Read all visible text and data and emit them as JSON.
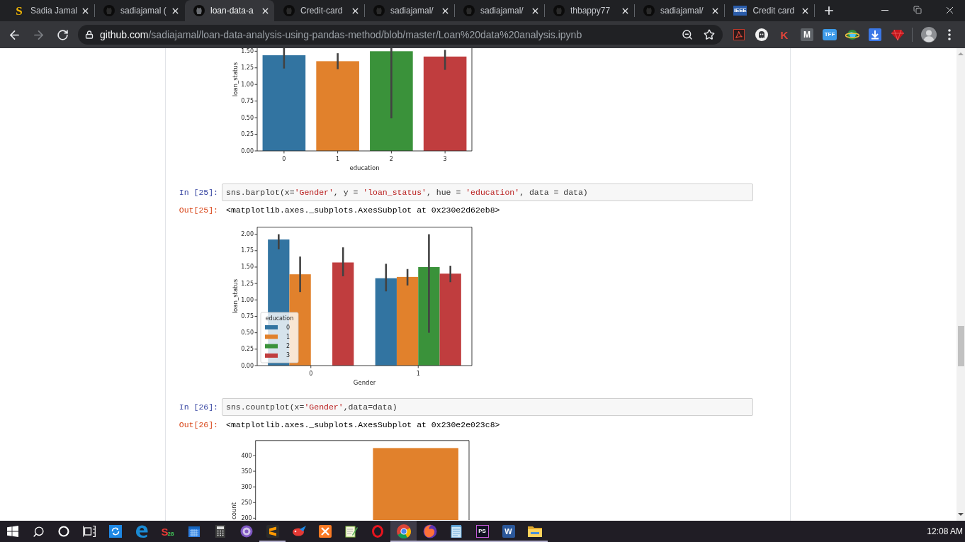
{
  "tabs": [
    {
      "title": "Sadia Jamal",
      "favicon": {
        "kind": "letter",
        "text": "S"
      },
      "selected": false
    },
    {
      "title": "sadiajamal (",
      "favicon": {
        "kind": "cat"
      },
      "selected": false
    },
    {
      "title": "loan-data-a",
      "favicon": {
        "kind": "cat"
      },
      "selected": true
    },
    {
      "title": "Credit-card",
      "favicon": {
        "kind": "cat"
      },
      "selected": false
    },
    {
      "title": "sadiajamal/",
      "favicon": {
        "kind": "cat"
      },
      "selected": false
    },
    {
      "title": "sadiajamal/",
      "favicon": {
        "kind": "cat"
      },
      "selected": false
    },
    {
      "title": "thbappy77",
      "favicon": {
        "kind": "cat"
      },
      "selected": false
    },
    {
      "title": "sadiajamal/",
      "favicon": {
        "kind": "cat"
      },
      "selected": false
    },
    {
      "title": "Credit card",
      "favicon": {
        "kind": "tile",
        "text": "IEEE"
      },
      "selected": false
    }
  ],
  "toolbar": {
    "back": {
      "disabled": false
    },
    "forward": {
      "disabled": true
    }
  },
  "address_bar": {
    "host": "github.com",
    "path": "/sadiajamal/loan-data-analysis-using-pandas-method/blob/master/Loan%20data%20analysis.ipynb"
  },
  "extensions": [
    {
      "kind": "pdf"
    },
    {
      "kind": "ghost"
    },
    {
      "kind": "letter",
      "text": "K"
    },
    {
      "kind": "square",
      "text": "M"
    },
    {
      "kind": "badge",
      "text": "TFF"
    },
    {
      "kind": "globe"
    },
    {
      "kind": "download"
    },
    {
      "kind": "gem"
    }
  ],
  "notebook": {
    "cells": [
      {
        "kind": "figure",
        "chart_data": {
          "type": "bar",
          "xlabel": "education",
          "ylabel": "loan_status",
          "categories": [
            "0",
            "1",
            "2",
            "3"
          ],
          "colors": [
            "#3274a1",
            "#e1812c",
            "#3a923a",
            "#c03d3e"
          ],
          "series": [
            {
              "values": [
                1.44,
                1.35,
                1.5,
                1.42
              ],
              "errors": [
                [
                  1.24,
                  1.55
                ],
                [
                  1.23,
                  1.47
                ],
                [
                  0.49,
                  1.55
                ],
                [
                  1.22,
                  1.52
                ]
              ]
            }
          ],
          "ylim": [
            0,
            1.546
          ],
          "yticks": [
            {
              "value": 0,
              "label": "0.00"
            },
            {
              "value": 0.25,
              "label": "0.25"
            },
            {
              "value": 0.5,
              "label": "0.50"
            },
            {
              "value": 0.75,
              "label": "0.75"
            },
            {
              "value": 1,
              "label": "1.00"
            },
            {
              "value": 1.25,
              "label": "1.25"
            },
            {
              "value": 1.5,
              "label": "1.50"
            }
          ]
        }
      },
      {
        "kind": "code",
        "input_prompt": "In [25]:",
        "code": [
          {
            "kind": "plain",
            "text": "sns.barplot(x="
          },
          {
            "kind": "string",
            "text": "'Gender'"
          },
          {
            "kind": "plain",
            "text": ", y = "
          },
          {
            "kind": "string",
            "text": "'loan_status'"
          },
          {
            "kind": "plain",
            "text": ", hue = "
          },
          {
            "kind": "string",
            "text": "'education'"
          },
          {
            "kind": "plain",
            "text": ", data = data)"
          }
        ],
        "output_prompt": "Out[25]:",
        "output": "<matplotlib.axes._subplots.AxesSubplot at 0x230e2d62eb8>"
      },
      {
        "kind": "figure",
        "chart_data": {
          "type": "bar",
          "xlabel": "Gender",
          "ylabel": "loan_status",
          "categories": [
            "0",
            "1"
          ],
          "legend": "lower left",
          "legend_title": "education",
          "series": [
            {
              "name": "0",
              "color": "#3274a1",
              "values": [
                1.92,
                1.33
              ],
              "errors": [
                [
                  1.77,
                  2.0
                ],
                [
                  1.13,
                  1.55
                ]
              ]
            },
            {
              "name": "1",
              "color": "#e1812c",
              "values": [
                1.39,
                1.35
              ],
              "errors": [
                [
                  1.12,
                  1.66
                ],
                [
                  1.22,
                  1.47
                ]
              ]
            },
            {
              "name": "2",
              "color": "#3a923a",
              "values": [
                null,
                1.5
              ],
              "errors": [
                null,
                [
                  0.5,
                  2.0
                ]
              ]
            },
            {
              "name": "3",
              "color": "#c03d3e",
              "values": [
                1.57,
                1.4
              ],
              "errors": [
                [
                  1.36,
                  1.8
                ],
                [
                  1.27,
                  1.52
                ]
              ]
            }
          ],
          "ylim": [
            0,
            2.108
          ],
          "yticks": [
            {
              "value": 0,
              "label": "0.00"
            },
            {
              "value": 0.25,
              "label": "0.25"
            },
            {
              "value": 0.5,
              "label": "0.50"
            },
            {
              "value": 0.75,
              "label": "0.75"
            },
            {
              "value": 1,
              "label": "1.00"
            },
            {
              "value": 1.25,
              "label": "1.25"
            },
            {
              "value": 1.5,
              "label": "1.50"
            },
            {
              "value": 1.75,
              "label": "1.75"
            },
            {
              "value": 2,
              "label": "2.00"
            }
          ]
        }
      },
      {
        "kind": "code",
        "input_prompt": "In [26]:",
        "code": [
          {
            "kind": "plain",
            "text": "sns.countplot(x="
          },
          {
            "kind": "string",
            "text": "'Gender'"
          },
          {
            "kind": "plain",
            "text": ",data=data)"
          }
        ],
        "output_prompt": "Out[26]:",
        "output": "<matplotlib.axes._subplots.AxesSubplot at 0x230e2e023c8>"
      },
      {
        "kind": "figure",
        "chart_data": {
          "type": "bar",
          "ylabel": "count",
          "series": [
            {
              "color": "#e1812c",
              "values": [
                null,
                424
              ]
            }
          ],
          "ylim": [
            194,
            448
          ],
          "yticks": [
            200,
            250,
            300,
            350,
            400
          ]
        }
      }
    ]
  },
  "taskbar": {
    "apps": [
      {
        "kind": "sync",
        "running": false,
        "selected": false
      },
      {
        "kind": "e-logo",
        "running": false,
        "selected": false
      },
      {
        "kind": "letter",
        "text": "S",
        "badge": "28",
        "running": false,
        "selected": false
      },
      {
        "kind": "calendar",
        "running": false,
        "selected": false
      },
      {
        "kind": "calculator",
        "running": false,
        "selected": false
      },
      {
        "kind": "sphere",
        "running": false,
        "selected": false
      },
      {
        "kind": "s-tile",
        "running": true,
        "selected": false
      },
      {
        "kind": "bird",
        "running": false,
        "selected": false
      },
      {
        "kind": "x-tile",
        "running": false,
        "selected": false
      },
      {
        "kind": "notepad-pen",
        "running": false,
        "selected": false
      },
      {
        "kind": "o-ring",
        "running": false,
        "selected": false
      },
      {
        "kind": "wheel",
        "running": true,
        "selected": true
      },
      {
        "kind": "fox",
        "running": true,
        "selected": false
      },
      {
        "kind": "notepad",
        "running": true,
        "selected": false
      },
      {
        "kind": "framed-tile",
        "text": "PS",
        "running": true,
        "selected": false
      },
      {
        "kind": "plain-tile",
        "text": "W",
        "running": true,
        "selected": false
      },
      {
        "kind": "folder",
        "running": true,
        "selected": false
      }
    ],
    "clock": "12:08 AM"
  }
}
